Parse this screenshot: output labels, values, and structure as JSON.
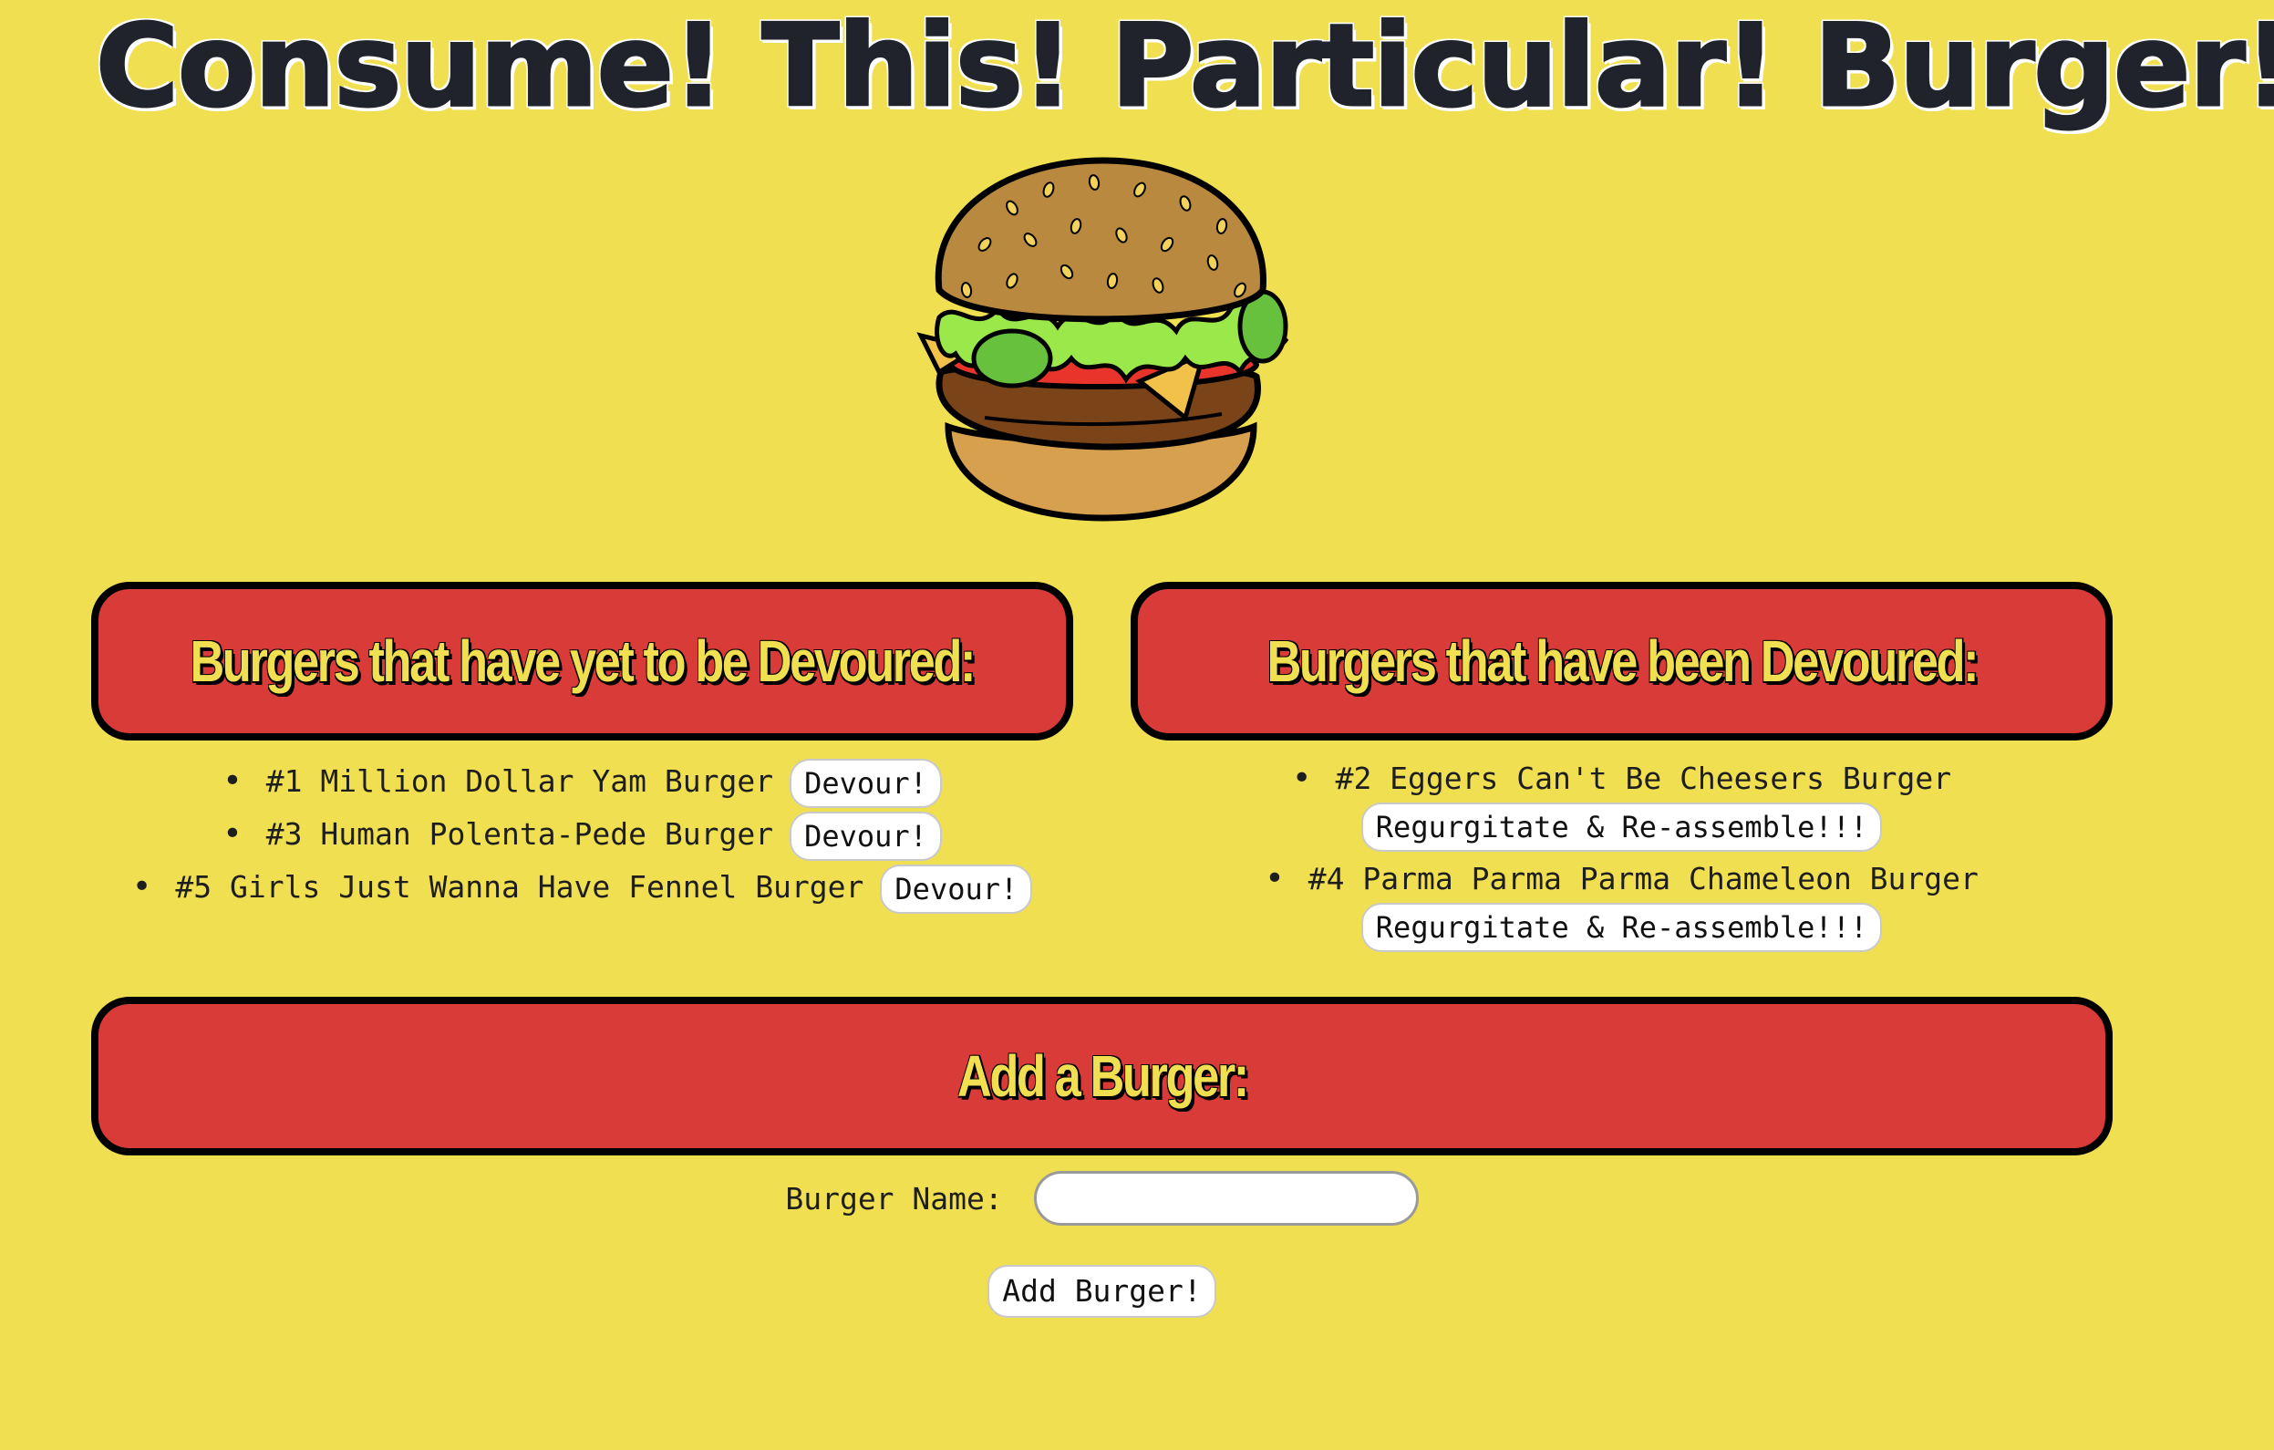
{
  "header": {
    "title": "Consume! This! Particular! Burger!"
  },
  "undevoured": {
    "heading": "Burgers that have yet to be Devoured:",
    "items": [
      {
        "label": "#1 Million Dollar Yam Burger",
        "button": "Devour!"
      },
      {
        "label": "#3 Human Polenta-Pede Burger",
        "button": "Devour!"
      },
      {
        "label": "#5 Girls Just Wanna Have Fennel Burger",
        "button": "Devour!"
      }
    ]
  },
  "devoured": {
    "heading": "Burgers that have been Devoured:",
    "items": [
      {
        "label": "#2 Eggers Can't Be Cheesers Burger",
        "button": "Regurgitate & Re-assemble!!!"
      },
      {
        "label": "#4 Parma Parma Parma Chameleon Burger",
        "button": "Regurgitate & Re-assemble!!!"
      }
    ]
  },
  "add_form": {
    "heading": "Add a Burger:",
    "name_label": "Burger Name:",
    "name_value": "",
    "submit_label": "Add Burger!"
  },
  "colors": {
    "background": "#f1df52",
    "panel": "#d93b39",
    "panel_text": "#f1df52",
    "title": "#20232b"
  },
  "icons": {
    "hero": "burger-illustration-icon"
  }
}
